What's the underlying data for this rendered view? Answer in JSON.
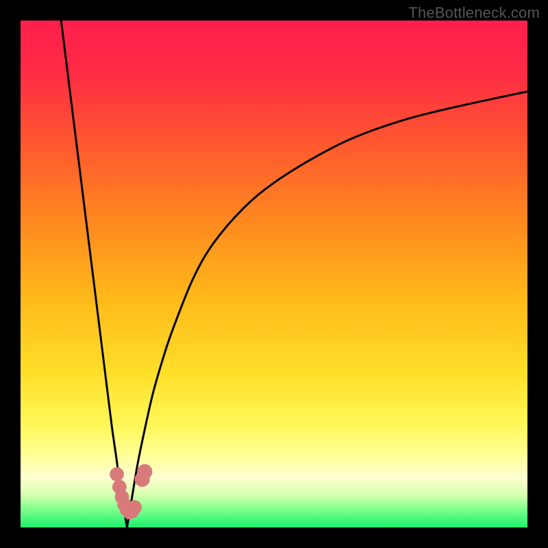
{
  "watermark": {
    "text": "TheBottleneck.com"
  },
  "colors": {
    "black": "#000000",
    "curve": "#000000",
    "marker": "#d97a7a",
    "gradient_stops": [
      {
        "offset": 0.0,
        "color": "#ff1f4b"
      },
      {
        "offset": 0.1,
        "color": "#ff2b45"
      },
      {
        "offset": 0.25,
        "color": "#ff5a2e"
      },
      {
        "offset": 0.4,
        "color": "#ff8a1f"
      },
      {
        "offset": 0.55,
        "color": "#ffba1a"
      },
      {
        "offset": 0.7,
        "color": "#ffe02a"
      },
      {
        "offset": 0.8,
        "color": "#fff85a"
      },
      {
        "offset": 0.86,
        "color": "#ffff9a"
      },
      {
        "offset": 0.9,
        "color": "#ffffd0"
      },
      {
        "offset": 0.935,
        "color": "#d8ffb0"
      },
      {
        "offset": 0.965,
        "color": "#7cff8c"
      },
      {
        "offset": 1.0,
        "color": "#1cee6e"
      }
    ]
  },
  "chart_data": {
    "type": "line",
    "title": "",
    "xlabel": "",
    "ylabel": "",
    "xlim": [
      0,
      100
    ],
    "ylim": [
      0,
      100
    ],
    "grid": false,
    "legend": false,
    "x_min_cusp": 21,
    "series": [
      {
        "name": "left-branch",
        "x": [
          8,
          10,
          12,
          14,
          16,
          17,
          18,
          19,
          19.5,
          20,
          20.5,
          21
        ],
        "y": [
          100,
          84,
          68,
          52,
          36,
          28,
          20,
          13,
          9,
          6,
          3,
          0
        ]
      },
      {
        "name": "right-branch",
        "x": [
          21,
          22,
          23,
          24,
          26,
          28,
          30,
          34,
          38,
          44,
          50,
          58,
          66,
          76,
          86,
          100
        ],
        "y": [
          0,
          6,
          12,
          17,
          26,
          33,
          39,
          49,
          56,
          63,
          68,
          73,
          77,
          80.5,
          83,
          86
        ]
      }
    ],
    "markers": [
      {
        "x": 19.0,
        "y": 10.5,
        "r": 1.4
      },
      {
        "x": 19.5,
        "y": 8.0,
        "r": 1.4
      },
      {
        "x": 20.0,
        "y": 6.0,
        "r": 1.4
      },
      {
        "x": 20.5,
        "y": 4.5,
        "r": 1.4
      },
      {
        "x": 21.0,
        "y": 3.5,
        "r": 1.4
      },
      {
        "x": 21.5,
        "y": 3.0,
        "r": 1.4
      },
      {
        "x": 22.0,
        "y": 3.2,
        "r": 1.4
      },
      {
        "x": 22.5,
        "y": 4.0,
        "r": 1.4
      },
      {
        "x": 24.0,
        "y": 9.5,
        "r": 1.5
      },
      {
        "x": 24.5,
        "y": 11.0,
        "r": 1.5
      }
    ]
  }
}
